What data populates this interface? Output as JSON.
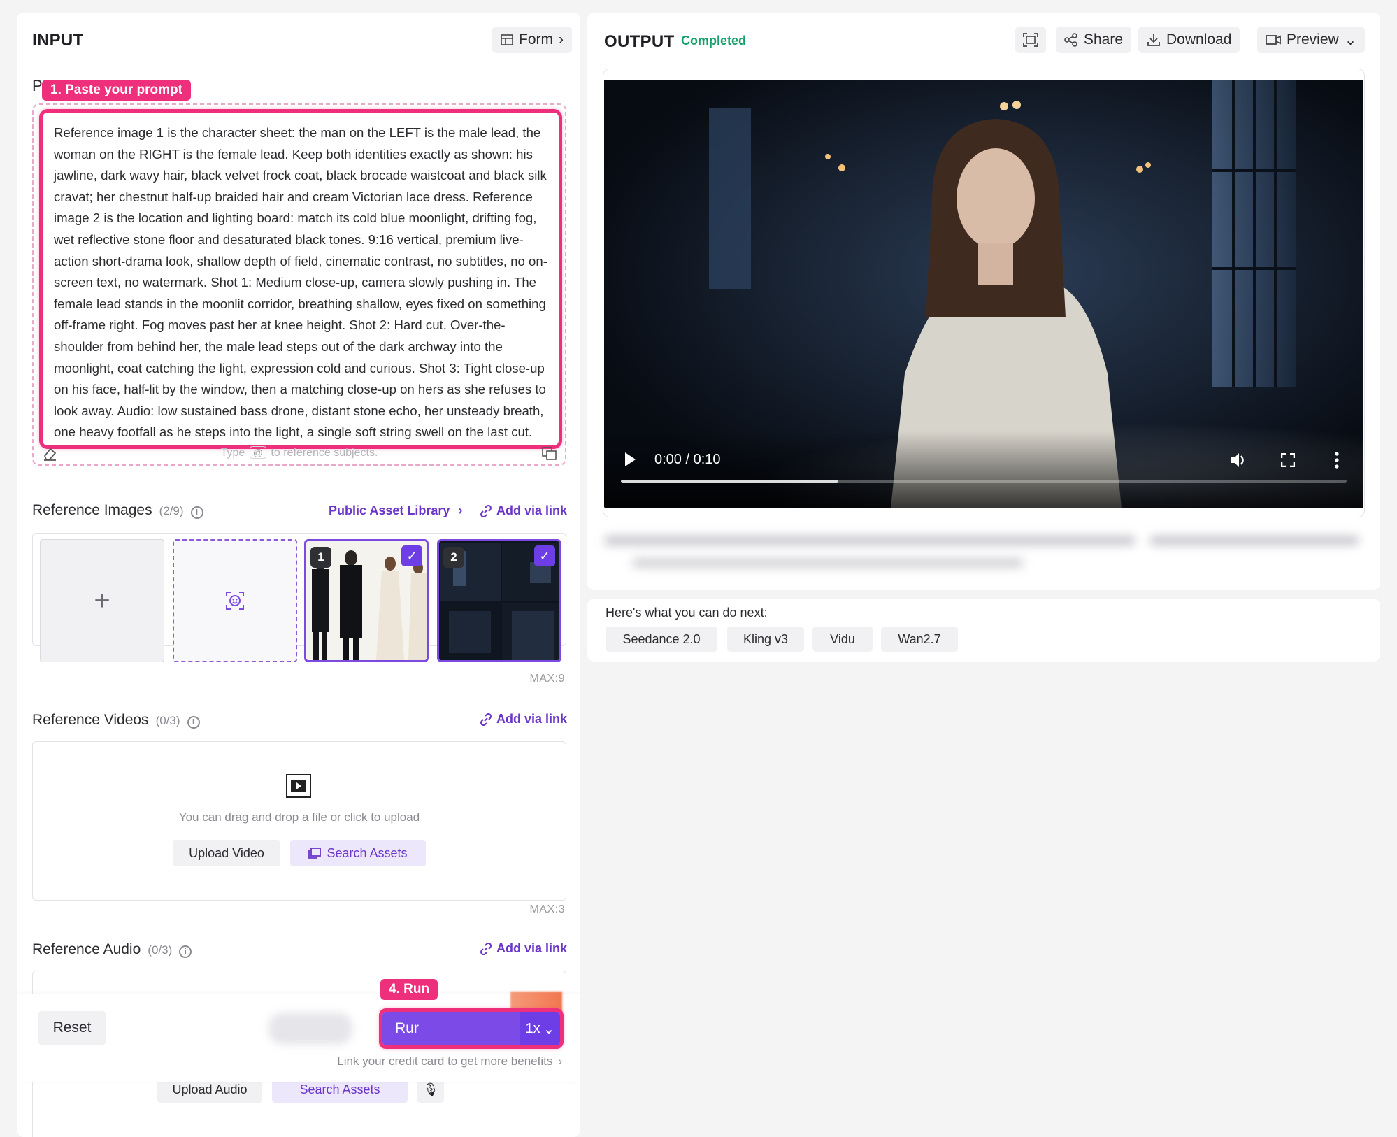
{
  "input": {
    "title": "INPUT",
    "form_label": "Form",
    "prompt_label": "P",
    "prompt_tag": "1. Paste your prompt",
    "prompt_text": "Reference image 1 is the character sheet: the man on the LEFT is the male lead, the woman on the RIGHT is the female lead. Keep both identities exactly as shown: his jawline, dark wavy hair, black velvet frock coat, black brocade waistcoat and black silk cravat; her chestnut half-up braided hair and cream Victorian lace dress. Reference image 2 is the location and lighting board: match its cold blue moonlight, drifting fog, wet reflective stone floor and desaturated black tones. 9:16 vertical, premium live-action short-drama look, shallow depth of field, cinematic contrast, no subtitles, no on-screen text, no watermark. Shot 1: Medium close-up, camera slowly pushing in. The female lead stands in the moonlit corridor, breathing shallow, eyes fixed on something off-frame right. Fog moves past her at knee height. Shot 2: Hard cut. Over-the-shoulder from behind her, the male lead steps out of the dark archway into the moonlight, coat catching the light, expression cold and curious. Shot 3: Tight close-up on his face, half-lit by the window, then a matching close-up on hers as she refuses to look away. Audio: low sustained bass drone, distant stone echo, her unsteady breath, one heavy footfall as he steps into the light, a single soft string swell on the last cut.",
    "hint_before": "Type",
    "hint_key": "@",
    "hint_after": "to reference subjects.",
    "ref_images": {
      "title": "Reference Images",
      "count": "(2/9)",
      "library_link": "Public Asset Library",
      "add_link": "Add via link",
      "max": "MAX:9",
      "thumb_numbers": [
        "1",
        "2"
      ]
    },
    "ref_videos": {
      "title": "Reference Videos",
      "count": "(0/3)",
      "add_link": "Add via link",
      "upload_hint": "You can drag and drop a file or click to upload",
      "upload_button": "Upload Video",
      "search_button": "Search Assets",
      "max": "MAX:3"
    },
    "ref_audio": {
      "title": "Reference Audio",
      "count": "(0/3)",
      "add_link": "Add via link",
      "upload_button": "Upload Audio",
      "search_button": "Search Assets"
    },
    "actions": {
      "reset": "Reset",
      "run_tag": "4. Run",
      "run": "Rur",
      "multiplier": "1x",
      "credit_link": "Link your credit card to get more benefits"
    }
  },
  "output": {
    "title": "OUTPUT",
    "status": "Completed",
    "share": "Share",
    "download": "Download",
    "preview": "Preview",
    "video_time": "0:00 / 0:10",
    "progress": 0.3,
    "next_title": "Here's what you can do next:",
    "models": [
      "Seedance 2.0",
      "Kling v3",
      "Vidu",
      "Wan2.7"
    ]
  },
  "colors": {
    "accent": "#6d3ee6",
    "highlight": "#ee2f7b",
    "status": "#15a06b"
  }
}
